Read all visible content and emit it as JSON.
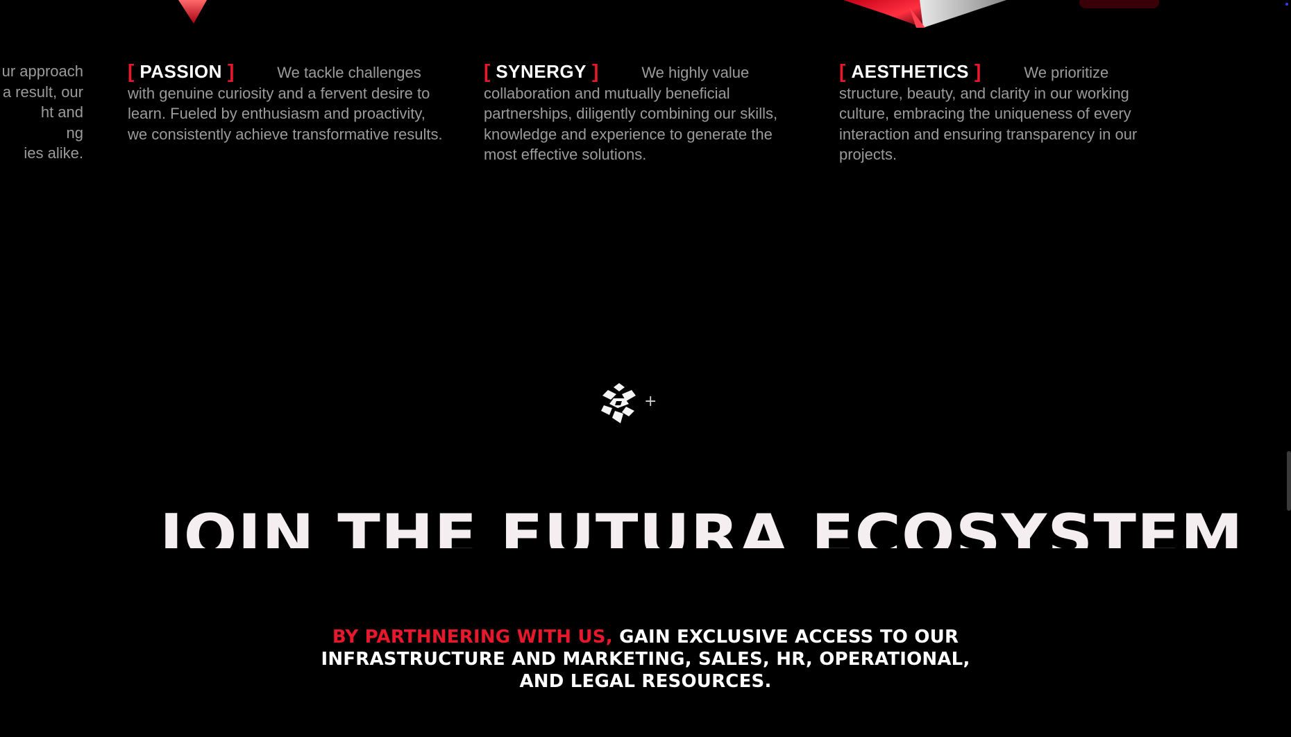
{
  "values": {
    "partial": {
      "lines": [
        "ur approach",
        "a result, our",
        "ht and",
        "ng",
        "ies alike."
      ]
    },
    "passion": {
      "title": "PASSION",
      "lead": "We tackle challenges",
      "body": "with genuine curiosity and a fervent desire to learn. Fueled by enthusiasm and proactivity, we consistently achieve transformative results."
    },
    "synergy": {
      "title": "SYNERGY",
      "lead": "We highly value",
      "body": "collaboration and mutually beneficial partnerships, diligently combining our skills, knowledge and experience to generate the most effective solutions."
    },
    "aesthetics": {
      "title": "AESTHETICS",
      "lead": "We prioritize",
      "body": "structure, beauty, and clarity in our working culture, embracing the uniqueness of every interaction and ensuring transparency in our projects."
    },
    "bracket_open": "[",
    "bracket_close": "]"
  },
  "join": {
    "plus": "+",
    "headline": "JOIN THE FUTURA ECOSYSTEM",
    "subline_accent": "BY PARTHNERING WITH US,",
    "subline_rest": "GAIN EXCLUSIVE ACCESS TO OUR INFRASTRUCTURE AND MARKETING, SALES, HR, OPERATIONAL, AND LEGAL RESOURCES."
  },
  "colors": {
    "accent": "#e8182c",
    "background": "#000000",
    "body_text": "#9b9b9b",
    "heading_text": "#ffffff"
  },
  "icons": {
    "logo": "futura-logo-icon",
    "plus": "plus-icon"
  }
}
